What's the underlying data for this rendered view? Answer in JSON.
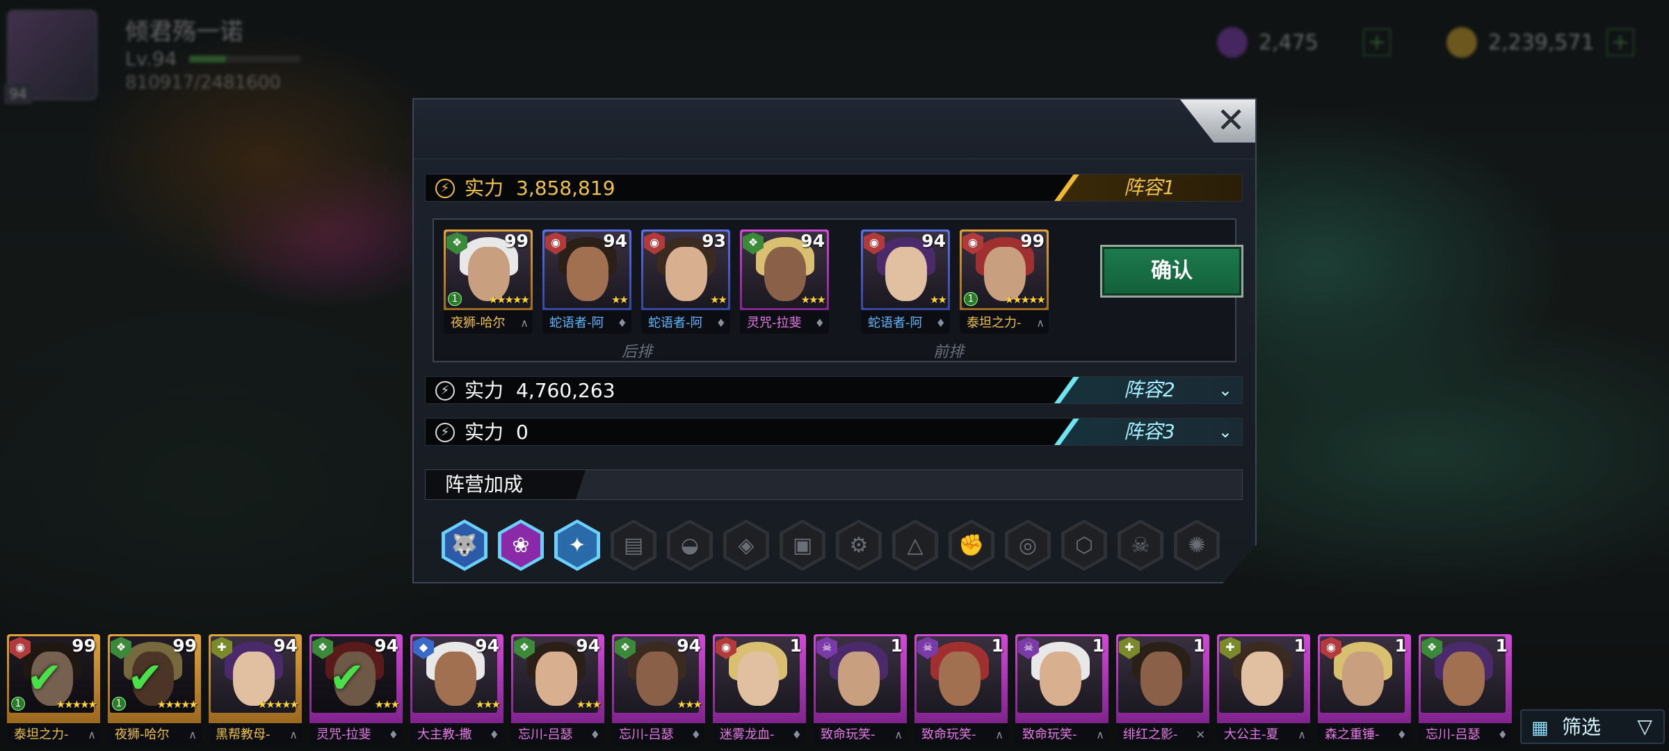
{
  "player": {
    "name": "倾君殇一诺",
    "level_text": "Lv.94",
    "exp_text": "810917/2481600",
    "exp_fraction": 0.33,
    "avatar_level": "94"
  },
  "currencies": [
    {
      "icon": "gem-icon",
      "value": "2,475",
      "color": "#7a3aa8"
    },
    {
      "icon": "gold-coin-icon",
      "value": "2,239,571",
      "color": "#c89a2a"
    }
  ],
  "modal": {
    "close_label": "✕",
    "teams": [
      {
        "power_label": "实力",
        "power_value": "3,858,819",
        "tag": "阵容1",
        "active": true
      },
      {
        "power_label": "实力",
        "power_value": "4,760,263",
        "tag": "阵容2",
        "active": false
      },
      {
        "power_label": "实力",
        "power_value": "0",
        "tag": "阵容3",
        "active": false
      }
    ],
    "back_row_label": "后排",
    "front_row_label": "前排",
    "confirm_label": "确认",
    "lineup": [
      {
        "name": "夜狮-哈尔",
        "level": "99",
        "rarity": "gold",
        "faction": "green",
        "stars": "★★★★★",
        "star_badge": "1",
        "class": "∧"
      },
      {
        "name": "蛇语者-阿",
        "level": "94",
        "rarity": "blue",
        "faction": "red",
        "stars": "★★",
        "star_badge": "",
        "class": "♦"
      },
      {
        "name": "蛇语者-阿",
        "level": "93",
        "rarity": "blue",
        "faction": "red",
        "stars": "★★",
        "star_badge": "",
        "class": "♦"
      },
      {
        "name": "灵咒-拉斐",
        "level": "94",
        "rarity": "purple",
        "faction": "green",
        "stars": "★★★",
        "star_badge": "",
        "class": "♦"
      },
      {
        "name": "蛇语者-阿",
        "level": "94",
        "rarity": "blue",
        "faction": "red",
        "stars": "★★",
        "star_badge": "",
        "class": "♦"
      },
      {
        "name": "泰坦之力-",
        "level": "99",
        "rarity": "gold",
        "faction": "red",
        "stars": "★★★★★",
        "star_badge": "1",
        "class": "∧"
      }
    ],
    "bonus_label": "阵营加成",
    "bonus_icons": [
      {
        "name": "wolf-faction-icon",
        "glyph": "🐺",
        "active": true,
        "color": "#2a5aa8"
      },
      {
        "name": "lotus-faction-icon",
        "glyph": "❀",
        "active": true,
        "color": "#8a2aa8"
      },
      {
        "name": "eagle-faction-icon",
        "glyph": "✦",
        "active": true,
        "color": "#2a6aa8"
      },
      {
        "name": "barrel-bonus-icon",
        "glyph": "▤",
        "active": false
      },
      {
        "name": "helmet-bonus-icon",
        "glyph": "◒",
        "active": false
      },
      {
        "name": "dice-bonus-icon",
        "glyph": "◈",
        "active": false
      },
      {
        "name": "chest-bonus-icon",
        "glyph": "▣",
        "active": false
      },
      {
        "name": "gear-bonus-icon",
        "glyph": "⚙",
        "active": false
      },
      {
        "name": "peak-bonus-icon",
        "glyph": "△",
        "active": false
      },
      {
        "name": "fist-bonus-icon",
        "glyph": "✊",
        "active": false
      },
      {
        "name": "spiral-bonus-icon",
        "glyph": "◎",
        "active": false
      },
      {
        "name": "crate-bonus-icon",
        "glyph": "⬡",
        "active": false
      },
      {
        "name": "skull-bonus-icon",
        "glyph": "☠",
        "active": false
      },
      {
        "name": "cog-bonus-icon",
        "glyph": "✺",
        "active": false
      }
    ]
  },
  "roster": [
    {
      "name": "泰坦之力-",
      "level": "99",
      "rarity": "gold",
      "faction": "red",
      "stars": "★★★★★",
      "star_badge": "1",
      "selected": true,
      "class": "∧"
    },
    {
      "name": "夜狮-哈尔",
      "level": "99",
      "rarity": "gold",
      "faction": "green",
      "stars": "★★★★★",
      "star_badge": "1",
      "selected": true,
      "class": "∧"
    },
    {
      "name": "黑帮教母-",
      "level": "94",
      "rarity": "gold",
      "faction": "olive",
      "stars": "★★★★★",
      "star_badge": "",
      "selected": false,
      "class": "∧"
    },
    {
      "name": "灵咒-拉斐",
      "level": "94",
      "rarity": "purple",
      "faction": "green",
      "stars": "★★★",
      "star_badge": "",
      "selected": true,
      "class": "♦"
    },
    {
      "name": "大主教-撒",
      "level": "94",
      "rarity": "purple",
      "faction": "blue",
      "stars": "★★★",
      "star_badge": "",
      "selected": false,
      "class": "♦"
    },
    {
      "name": "忘川-吕瑟",
      "level": "94",
      "rarity": "purple",
      "faction": "green",
      "stars": "★★★",
      "star_badge": "",
      "selected": false,
      "class": "♦"
    },
    {
      "name": "忘川-吕瑟",
      "level": "94",
      "rarity": "purple",
      "faction": "green",
      "stars": "★★★",
      "star_badge": "",
      "selected": false,
      "class": "♦"
    },
    {
      "name": "迷雾龙血-",
      "level": "1",
      "rarity": "purple",
      "faction": "red",
      "stars": "",
      "star_badge": "",
      "selected": false,
      "class": "♦"
    },
    {
      "name": "致命玩笑-",
      "level": "1",
      "rarity": "purple",
      "faction": "purple",
      "stars": "",
      "star_badge": "",
      "selected": false,
      "class": "∧"
    },
    {
      "name": "致命玩笑-",
      "level": "1",
      "rarity": "purple",
      "faction": "purple",
      "stars": "",
      "star_badge": "",
      "selected": false,
      "class": "∧"
    },
    {
      "name": "致命玩笑-",
      "level": "1",
      "rarity": "purple",
      "faction": "purple",
      "stars": "",
      "star_badge": "",
      "selected": false,
      "class": "∧"
    },
    {
      "name": "绯红之影-",
      "level": "1",
      "rarity": "purple",
      "faction": "olive",
      "stars": "",
      "star_badge": "",
      "selected": false,
      "class": "✕"
    },
    {
      "name": "大公主-夏",
      "level": "1",
      "rarity": "purple",
      "faction": "olive",
      "stars": "",
      "star_badge": "",
      "selected": false,
      "class": "∧"
    },
    {
      "name": "森之重锤-",
      "level": "1",
      "rarity": "purple",
      "faction": "red",
      "stars": "",
      "star_badge": "",
      "selected": false,
      "class": "♦"
    },
    {
      "name": "忘川-吕瑟",
      "level": "1",
      "rarity": "purple",
      "faction": "green",
      "stars": "",
      "star_badge": "",
      "selected": false,
      "class": "♦"
    }
  ],
  "filter": {
    "label": "筛选",
    "icon": "grid-icon",
    "dropdown_icon": "▽"
  }
}
